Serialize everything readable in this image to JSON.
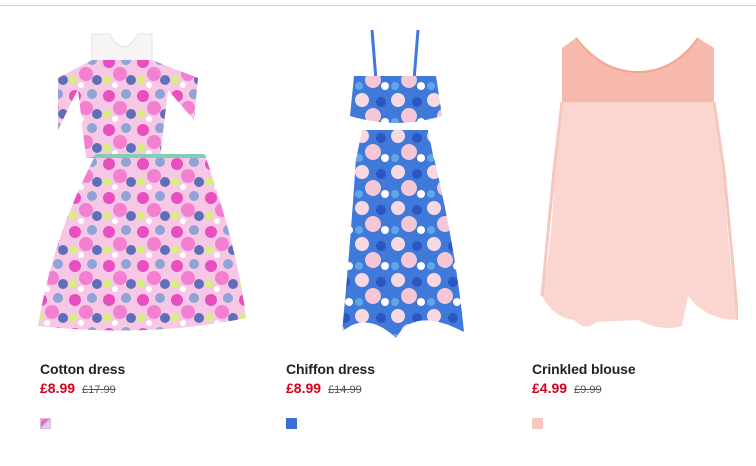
{
  "products": [
    {
      "name": "Cotton dress",
      "price": "£8.99",
      "old_price": "£17.99",
      "swatch_color": "#e86fc8",
      "image_icon": "floral-pink-dress-image"
    },
    {
      "name": "Chiffon dress",
      "price": "£8.99",
      "old_price": "£14.99",
      "swatch_color": "#3a6fd6",
      "image_icon": "floral-blue-dress-image"
    },
    {
      "name": "Crinkled blouse",
      "price": "£4.99",
      "old_price": "£9.99",
      "swatch_color": "#fbc6c1",
      "image_icon": "pink-blouse-image"
    }
  ],
  "colors": {
    "sale_price": "#d6001c",
    "title": "#222222",
    "old_price": "#555555"
  }
}
